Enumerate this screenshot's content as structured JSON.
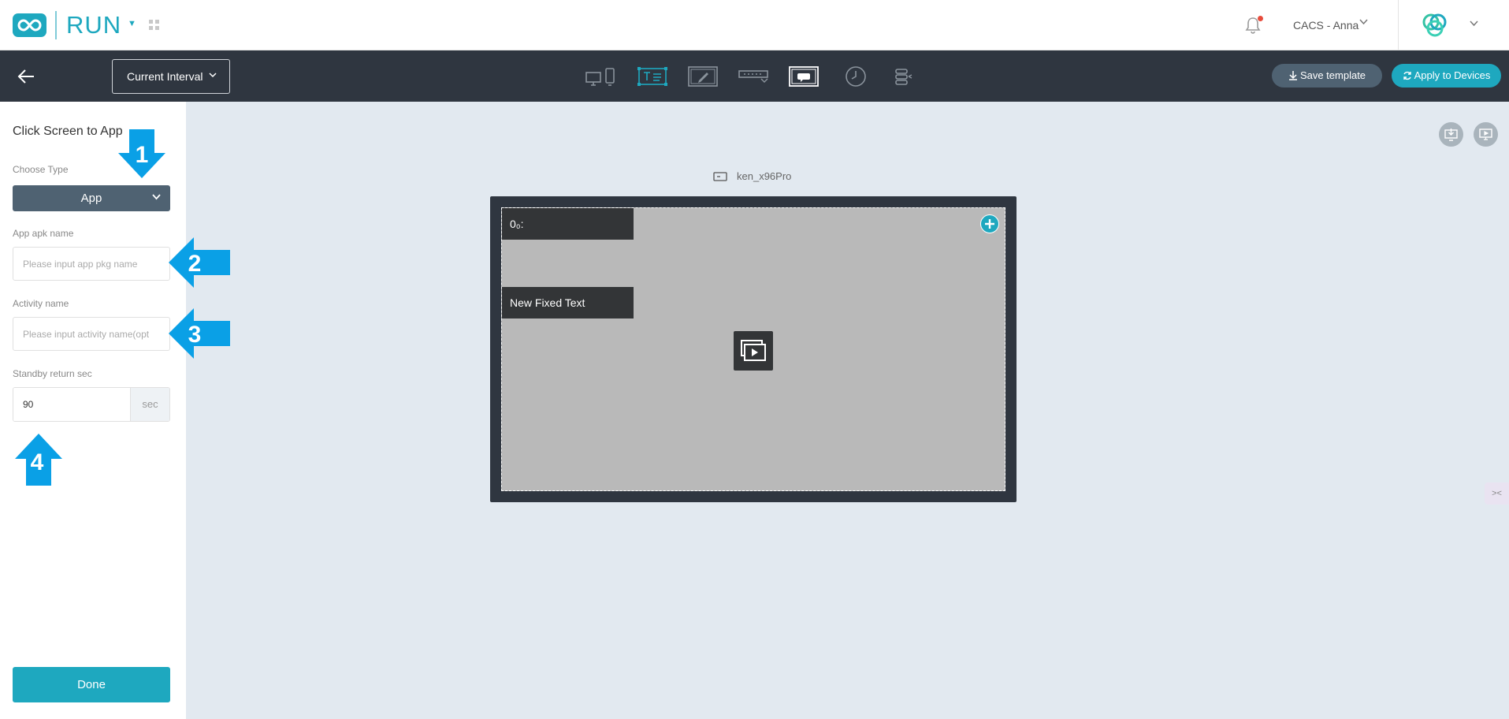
{
  "header": {
    "app_name": "RUN",
    "user_label": "CACS - Anna",
    "accent_color": "#1ea8bf"
  },
  "toolbar": {
    "interval_label": "Current Interval",
    "tools": [
      "multi-screen-icon",
      "text-icon",
      "edit-icon",
      "ticker-icon",
      "app-icon",
      "clock-icon",
      "layers-icon"
    ],
    "save_label": "Save template",
    "apply_label": "Apply to Devices"
  },
  "left_panel": {
    "title": "Click Screen to App",
    "choose_type_label": "Choose Type",
    "type_value": "App",
    "apk_label": "App apk name",
    "apk_placeholder": "Please input app pkg name",
    "activity_label": "Activity name",
    "activity_placeholder": "Please input activity name(opt",
    "standby_label": "Standby return sec",
    "standby_value": "90",
    "standby_unit": "sec",
    "done_label": "Done",
    "callouts": [
      "1",
      "2",
      "3",
      "4"
    ]
  },
  "canvas": {
    "device_name": "ken_x96Pro",
    "zones": [
      {
        "label": "0₀:"
      },
      {
        "label": "New Fixed Text"
      }
    ]
  }
}
